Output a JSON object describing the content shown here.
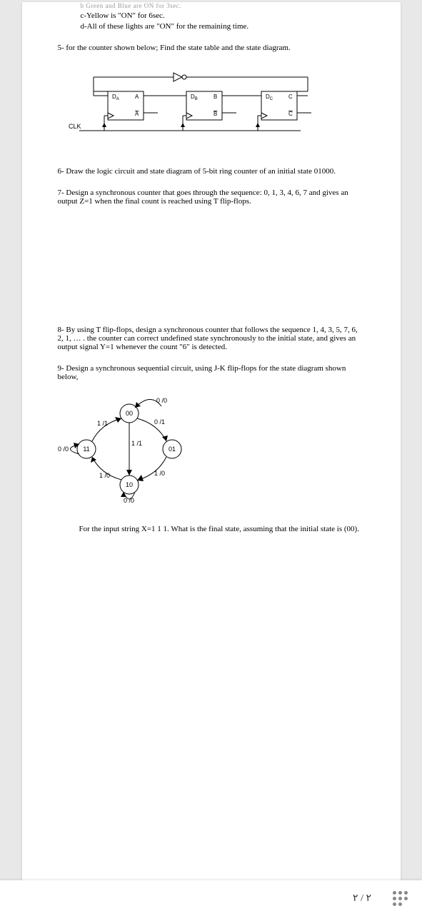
{
  "partial_top": "b Green and Blue are ON for 3sec.",
  "item_c": "c-Yellow is \"ON\" for 6sec.",
  "item_d": "d-All of these lights are \"ON\" for the remaining time.",
  "q5": "5- for the counter shown below; Find the state table and the state diagram.",
  "circuit": {
    "clk": "CLK",
    "da": "D",
    "da_sub": "A",
    "a": "A",
    "abar": "A",
    "db": "D",
    "db_sub": "B",
    "b": "B",
    "bbar": "B",
    "dc": "D",
    "dc_sub": "C",
    "c": "C",
    "cbar": "C"
  },
  "q6": "6- Draw the logic circuit and state diagram of 5-bit ring counter of an initial state 01000.",
  "q7": "7- Design a synchronous counter that goes through the sequence: 0, 1, 3, 4, 6, 7 and gives an output Z=1 when the final count is reached using T flip-flops.",
  "q8": "8- By using T flip-flops, design a synchronous counter that follows the sequence 1, 4, 3, 5, 7, 6, 2, 1, … . the counter can correct undefined state synchronously to the initial state, and gives an output signal Y=1 whenever the count \"6\" is detected.",
  "q9": "9- Design a synchronous sequential circuit, using J-K flip-flops for the state diagram shown below,",
  "state_diagram": {
    "s00": "00",
    "s01": "01",
    "s10": "10",
    "s11": "11",
    "e_00_01": "0 /1",
    "e_00_11_self11": "1 /1",
    "e_00_loop": "0 /0",
    "e_01_10": "1 /0",
    "e_10_11": "1 /0",
    "e_11_00": "1 /1",
    "e_11_loop": "0 /0",
    "e_10_loop": "0 /0"
  },
  "q9_final": "For the input string X=1 1 1. What is the final state, assuming that the initial state is (00).",
  "page_num": "٢ / ٢"
}
